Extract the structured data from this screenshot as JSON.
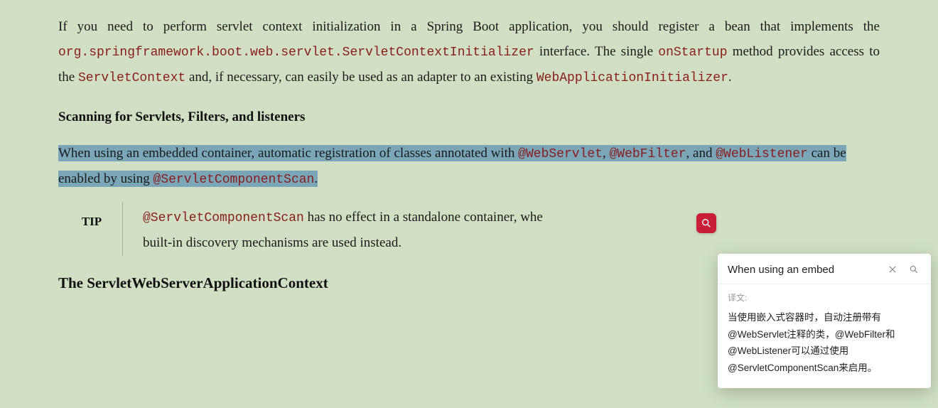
{
  "para1": {
    "t1": "If you need to perform servlet context initialization in a Spring Boot application, you should register a bean that implements the ",
    "c1": "org.springframework.boot.web.servlet.ServletContextInitializer",
    "t2": " interface. The single ",
    "c2": "onStartup",
    "t3": " method provides access to the ",
    "c3": "ServletContext",
    "t4": " and, if necessary, can easily be used as an adapter to an existing ",
    "c4": "WebApplicationInitializer",
    "t5": "."
  },
  "subhead1": "Scanning for Servlets, Filters, and listeners",
  "para2": {
    "t1": "When using an embedded container, automatic registration of classes anno",
    "t1b": "ta",
    "t1c": "ted with ",
    "c1": "@WebServlet",
    "t2": ", ",
    "c2": "@WebFilter",
    "t3": ", and ",
    "c3": "@WebListener",
    "t4": " can be enabled by using ",
    "c4": "@ServletComponentScan",
    "t5": "."
  },
  "tip": {
    "label": "TIP",
    "c1": "@ServletComponentScan",
    "t1": " has no effect in a standalone container, whe",
    "t2": "built-in discovery mechanisms are used instead."
  },
  "secthead2": "The ServletWebServerApplicationContext",
  "popup": {
    "source": "When using an embed",
    "label": "译文:",
    "translation": "当使用嵌入式容器时，自动注册带有@WebServlet注释的类，@WebFilter和@WebListener可以通过使用@ServletComponentScan来启用。"
  }
}
